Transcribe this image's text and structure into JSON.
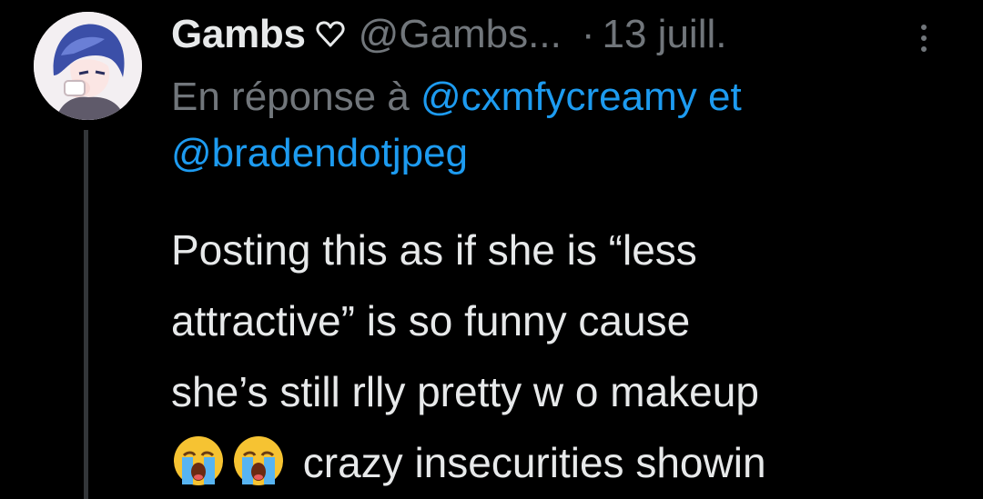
{
  "tweet": {
    "author": {
      "display_name": "Gambs",
      "badge_icon": "heart-outline-icon",
      "handle": "@Gambs...",
      "avatar": "avatar-image"
    },
    "separator": "·",
    "date": "13 juill.",
    "more_icon": "more-vertical-icon",
    "reply_context": {
      "prefix": "En réponse à",
      "mention_1": "@cxmfycreamy",
      "conjunction": "et",
      "mention_2": "@bradendotjpeg"
    },
    "body": {
      "line_1": "Posting this as if she is “less",
      "line_2": "attractive” is so funny cause",
      "line_3": "she’s still rlly pretty w o makeup",
      "emojis": [
        "loudly-crying-face-emoji",
        "loudly-crying-face-emoji"
      ],
      "line_4_text": "crazy insecurities showin"
    }
  },
  "colors": {
    "background": "#000000",
    "primary_text": "#e7e9ea",
    "secondary_text": "#71767b",
    "link": "#1d9bf0",
    "thread_line": "#333639"
  }
}
